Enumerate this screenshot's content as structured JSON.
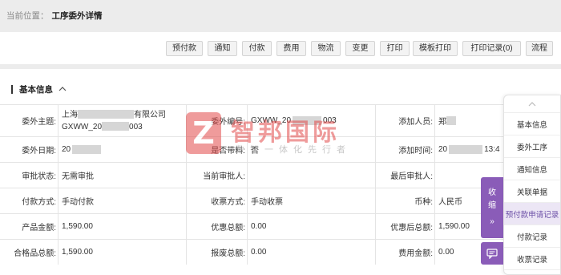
{
  "breadcrumb": {
    "label": "当前位置：",
    "value": "工序委外详情"
  },
  "toolbar": {
    "buttons": [
      "预付款",
      "通知",
      "付款",
      "费用",
      "物流",
      "变更",
      "打印",
      "模板打印",
      "打印记录(0)",
      "流程"
    ]
  },
  "section": {
    "title": "基本信息"
  },
  "fields": {
    "subject_label": "委外主题:",
    "subject_line1_a": "上海",
    "subject_line1_b": "有限公司",
    "subject_line2_a": "GXWW_20",
    "subject_line2_b": "003",
    "code_label": "委外编号:",
    "code_a": "GXWW_20",
    "code_b": "003",
    "adder_label": "添加人员:",
    "adder_value": "郑",
    "date_label": "委外日期:",
    "date_value": "20",
    "needs_material_label": "是否带料:",
    "needs_material_value": "否",
    "add_time_label": "添加时间:",
    "add_time_a": "20",
    "add_time_b": "13:4",
    "approval_status_label": "审批状态:",
    "approval_status_value": "无需审批",
    "current_approver_label": "当前审批人:",
    "current_approver_value": "",
    "last_approver_label": "最后审批人:",
    "last_approver_value": "",
    "pay_method_label": "付款方式:",
    "pay_method_value": "手动付款",
    "collect_method_label": "收票方式:",
    "collect_method_value": "手动收票",
    "currency_label": "币种:",
    "currency_value": "人民币",
    "product_amount_label": "产品金额:",
    "product_amount_value": "1,590.00",
    "discount_total_label": "优惠总额:",
    "discount_total_value": "0.00",
    "after_discount_label": "优惠后总额:",
    "after_discount_value": "1,590.00",
    "qualified_total_label": "合格品总额:",
    "qualified_total_value": "1,590.00",
    "scrap_total_label": "报废总额:",
    "scrap_total_value": "0.00",
    "fee_amount_label": "费用金额:",
    "fee_amount_value": "0.00"
  },
  "watermark": {
    "brand": "智邦国际",
    "slogan": "数智一体化先行者"
  },
  "right_nav": {
    "items": [
      "基本信息",
      "委外工序",
      "通知信息",
      "关联单据",
      "预付款申请记录",
      "付款记录",
      "收票记录"
    ]
  },
  "collapse": {
    "label_1": "收",
    "label_2": "缩",
    "arrow": "»"
  },
  "colors": {
    "accent": "#8a5cb8",
    "active_nav_bg": "#ece6f5",
    "watermark_red": "#e24a4a"
  }
}
